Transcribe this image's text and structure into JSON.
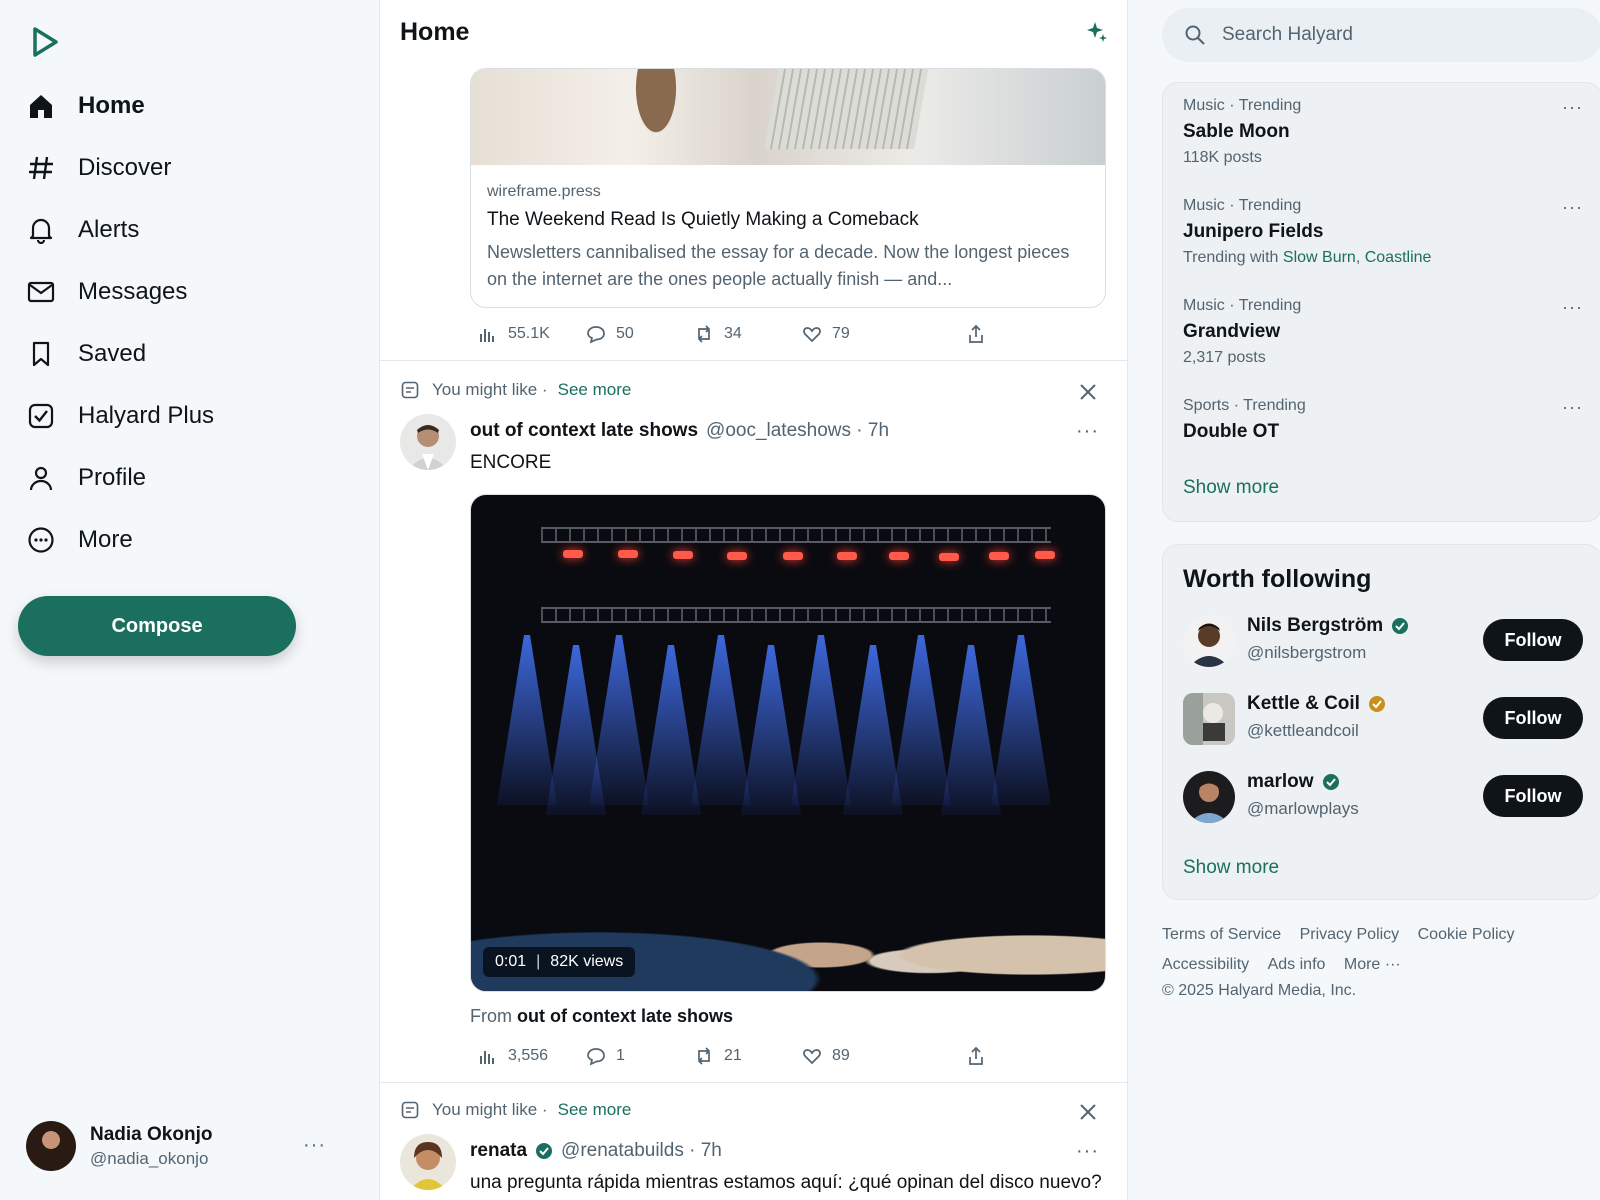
{
  "app": {
    "brand_color": "#1b6f5e",
    "logo_icon": "play-logo-icon"
  },
  "nav": [
    {
      "label": "Home",
      "icon": "home-icon",
      "active": true
    },
    {
      "label": "Discover",
      "icon": "hash-icon"
    },
    {
      "label": "Alerts",
      "icon": "bell-icon"
    },
    {
      "label": "Messages",
      "icon": "mail-icon"
    },
    {
      "label": "Saved",
      "icon": "bookmark-icon"
    },
    {
      "label": "Halyard Plus",
      "icon": "check-square-icon"
    },
    {
      "label": "Profile",
      "icon": "person-icon"
    },
    {
      "label": "More",
      "icon": "more-circle-icon"
    }
  ],
  "compose_label": "Compose",
  "account": {
    "name": "Nadia Okonjo",
    "handle": "@nadia_okonjo"
  },
  "feed": {
    "title": "Home",
    "link_post": {
      "domain": "wireframe.press",
      "title": "The Weekend Read Is Quietly Making a Comeback",
      "description": "Newsletters cannibalised the essay for a decade. Now the longest pieces on the internet are the ones people actually finish — and...",
      "views": "55.1K",
      "replies": "50",
      "reposts": "34",
      "likes": "79"
    },
    "suggestion_1": {
      "label": "You might like ·",
      "see_more": "See more",
      "name": "out of context late shows",
      "meta": "@ooc_lateshows · 7h",
      "text": "ENCORE",
      "video_time": "0:01",
      "video_views": "82K views",
      "from_prefix": "From",
      "from_name": "out of context late shows",
      "views": "3,556",
      "replies": "1",
      "reposts": "21",
      "likes": "89"
    },
    "suggestion_2": {
      "label": "You might like ·",
      "see_more": "See more",
      "name": "renata",
      "meta": "@renatabuilds · 7h",
      "text": "una pregunta rápida mientras estamos aquí: ¿qué opinan del disco nuevo?"
    }
  },
  "search": {
    "placeholder": "Search Halyard"
  },
  "trends": [
    {
      "category": "Music · Trending",
      "name": "Sable Moon",
      "count": "118K posts"
    },
    {
      "category": "Music · Trending",
      "name": "Junipero Fields",
      "count_prefix": "Trending with",
      "link1": "Slow Burn",
      "link2": "Coastline"
    },
    {
      "category": "Music · Trending",
      "name": "Grandview",
      "count": "2,317 posts"
    },
    {
      "category": "Sports · Trending",
      "name": "Double OT"
    }
  ],
  "trends_show_more": "Show more",
  "who_to_follow": {
    "title": "Worth following",
    "users": [
      {
        "name": "Nils Bergström",
        "handle": "@nilsbergstrom",
        "verified_color": "#1b6f5e",
        "button": "Follow"
      },
      {
        "name": "Kettle & Coil",
        "handle": "@kettleandcoil",
        "verified_color": "#c8901a",
        "button": "Follow"
      },
      {
        "name": "marlow",
        "handle": "@marlowplays",
        "verified_color": "#1b6f5e",
        "button": "Follow"
      }
    ],
    "show_more": "Show more"
  },
  "footer": {
    "links": [
      "Terms of Service",
      "Privacy Policy",
      "Cookie Policy",
      "Accessibility",
      "Ads info",
      "More ···"
    ],
    "copyright": "© 2025 Halyard Media, Inc."
  }
}
